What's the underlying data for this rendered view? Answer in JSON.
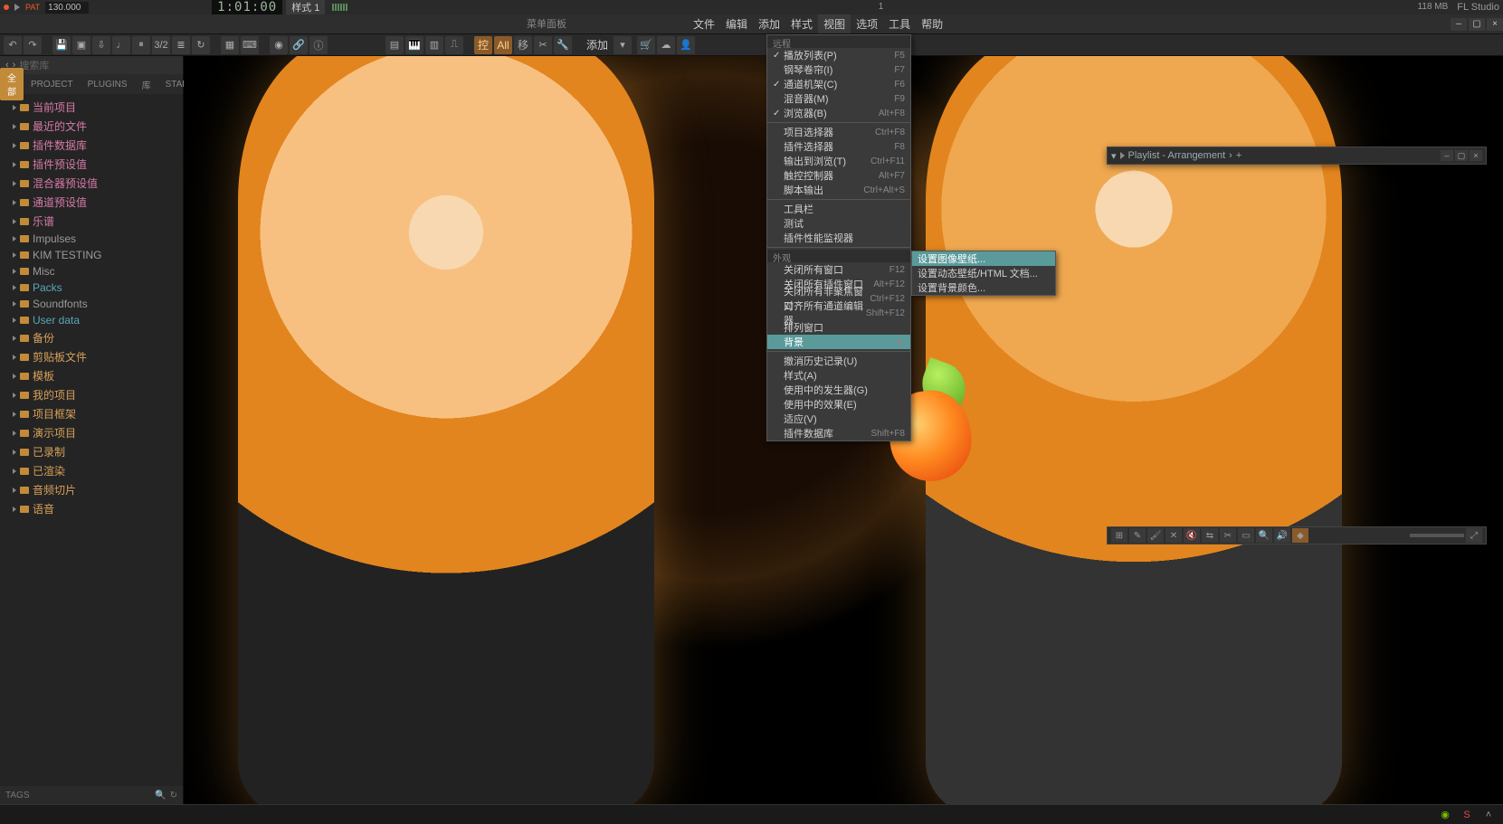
{
  "topbar": {
    "tempo": "130.000",
    "pat_label": "PAT",
    "time": "1:01:00",
    "pattern": "样式 1",
    "mem_val": "118 MB",
    "mem_num": "1",
    "appname": "FL Studio"
  },
  "hint": "菜单面板",
  "menubar": {
    "items": [
      "文件",
      "编辑",
      "添加",
      "样式",
      "视图",
      "选项",
      "工具",
      "帮助"
    ],
    "active_index": 4
  },
  "toolbar": {
    "group_right": [
      "控",
      "All",
      "移"
    ],
    "add": "添加"
  },
  "sidebar": {
    "search_placeholder": "搜索库",
    "tabs": [
      "全部",
      "PROJECT",
      "PLUGINS",
      "库",
      "STARRED"
    ],
    "nodes": [
      {
        "label": "当前项目",
        "cls": "pink"
      },
      {
        "label": "最近的文件",
        "cls": "pink"
      },
      {
        "label": "插件数据库",
        "cls": "pink"
      },
      {
        "label": "插件预设值",
        "cls": "pink"
      },
      {
        "label": "混合器预设值",
        "cls": "pink"
      },
      {
        "label": "通道预设值",
        "cls": "pink"
      },
      {
        "label": "乐谱",
        "cls": "pink"
      },
      {
        "label": "Impulses",
        "cls": "gray"
      },
      {
        "label": "KIM TESTING",
        "cls": "gray"
      },
      {
        "label": "Misc",
        "cls": "gray"
      },
      {
        "label": "Packs",
        "cls": "cyan"
      },
      {
        "label": "Soundfonts",
        "cls": "gray"
      },
      {
        "label": "User data",
        "cls": "cyan"
      },
      {
        "label": "备份",
        "cls": "orange"
      },
      {
        "label": "剪贴板文件",
        "cls": "orange"
      },
      {
        "label": "模板",
        "cls": "orange"
      },
      {
        "label": "我的项目",
        "cls": "orange"
      },
      {
        "label": "项目框架",
        "cls": "orange"
      },
      {
        "label": "演示项目",
        "cls": "orange"
      },
      {
        "label": "已录制",
        "cls": "orange"
      },
      {
        "label": "已渲染",
        "cls": "orange"
      },
      {
        "label": "音频切片",
        "cls": "orange"
      },
      {
        "label": "语音",
        "cls": "orange"
      }
    ],
    "bottom": "TAGS"
  },
  "dropdown": {
    "sections": [
      {
        "header": "远程",
        "rows": []
      },
      {
        "rows": [
          {
            "chk": "✓",
            "label": "播放列表(P)",
            "sc": "F5"
          },
          {
            "chk": "",
            "label": "钢琴卷帘(I)",
            "sc": "F7"
          },
          {
            "chk": "✓",
            "label": "通道机架(C)",
            "sc": "F6"
          },
          {
            "chk": "",
            "label": "混音器(M)",
            "sc": "F9"
          },
          {
            "chk": "✓",
            "label": "浏览器(B)",
            "sc": "Alt+F8"
          }
        ]
      },
      {
        "rows": [
          {
            "chk": "",
            "label": "项目选择器",
            "sc": "Ctrl+F8"
          },
          {
            "chk": "",
            "label": "插件选择器",
            "sc": "F8"
          },
          {
            "chk": "",
            "label": "输出到浏览(T)",
            "sc": "Ctrl+F11"
          },
          {
            "chk": "",
            "label": "触控控制器",
            "sc": "Alt+F7"
          },
          {
            "chk": "",
            "label": "脚本输出",
            "sc": "Ctrl+Alt+S"
          }
        ]
      },
      {
        "rows": [
          {
            "chk": "",
            "label": "工具栏",
            "sc": ""
          },
          {
            "chk": "",
            "label": "测试",
            "sc": ""
          },
          {
            "chk": "",
            "label": "插件性能监视器",
            "sc": ""
          }
        ]
      },
      {
        "header": "外观",
        "rows": []
      },
      {
        "rows": [
          {
            "chk": "",
            "label": "关闭所有窗口",
            "sc": "F12"
          },
          {
            "chk": "",
            "label": "关闭所有插件窗口",
            "sc": "Alt+F12"
          },
          {
            "chk": "",
            "label": "关闭所有非聚焦窗口",
            "sc": "Ctrl+F12"
          },
          {
            "chk": "",
            "label": "对齐所有通道编辑器",
            "sc": "Shift+F12"
          },
          {
            "chk": "",
            "label": "排列窗口",
            "sc": ""
          },
          {
            "chk": "",
            "label": "背景",
            "sc": "",
            "arrow": true,
            "hov": true
          }
        ]
      },
      {
        "rows": [
          {
            "chk": "",
            "label": "撤消历史记录(U)",
            "sc": ""
          },
          {
            "chk": "",
            "label": "样式(A)",
            "sc": ""
          },
          {
            "chk": "",
            "label": "使用中的发生器(G)",
            "sc": ""
          },
          {
            "chk": "",
            "label": "使用中的效果(E)",
            "sc": ""
          },
          {
            "chk": "",
            "label": "适应(V)",
            "sc": ""
          },
          {
            "chk": "",
            "label": "插件数据库",
            "sc": "Shift+F8"
          }
        ]
      }
    ]
  },
  "submenu": {
    "rows": [
      {
        "label": "设置图像壁纸...",
        "hov": true
      },
      {
        "label": "设置动态壁纸/HTML 文档...",
        "hov": false
      },
      {
        "label": "设置背景颜色...",
        "hov": false
      }
    ]
  },
  "playlist": {
    "title": "Playlist - Arrangement"
  },
  "taskbar": {
    "time": ""
  }
}
